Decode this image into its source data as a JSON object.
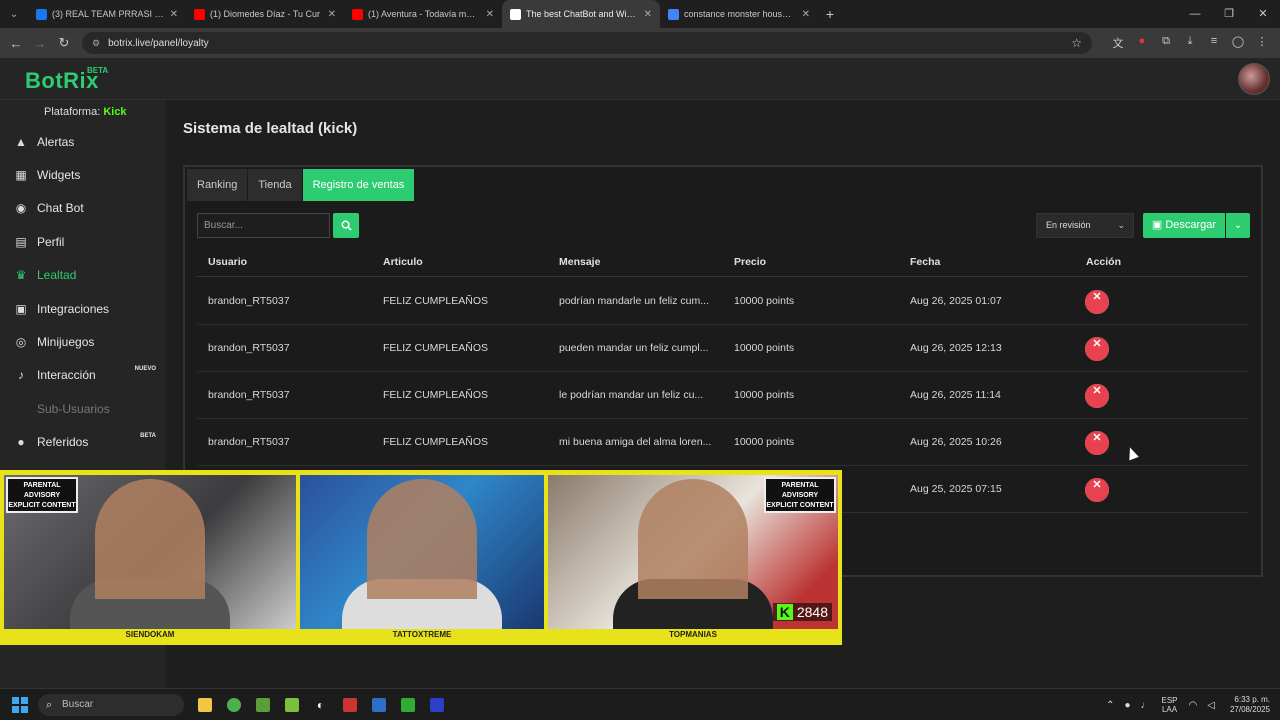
{
  "browser": {
    "tabs": [
      {
        "title": "(3) REAL TEAM PRRASI | Facebo",
        "color": "#1877f2",
        "icon": "facebook-icon"
      },
      {
        "title": "(1) Diomedes Díaz - Tu Cur",
        "color": "#ff0000",
        "icon": "youtube-icon"
      },
      {
        "title": "(1) Aventura - Todavía me ama",
        "color": "#ff0000",
        "icon": "youtube-icon"
      },
      {
        "title": "The best ChatBot and Widgets",
        "color": "#ffffff",
        "icon": "botrix-icon"
      },
      {
        "title": "constance monster house - Bus",
        "color": "#4285f4",
        "icon": "google-icon"
      }
    ],
    "url": "botrix.live/panel/loyalty"
  },
  "app": {
    "logo": "BotRix",
    "logo_badge": "BETA",
    "platform_label": "Plataforma:",
    "platform_value": "Kick",
    "accent": "#2ecc71"
  },
  "sidebar": {
    "items": [
      {
        "label": "Alertas",
        "icon": "warning-icon",
        "glyph": "▲"
      },
      {
        "label": "Widgets",
        "icon": "grid-icon",
        "glyph": "▦"
      },
      {
        "label": "Chat Bot",
        "icon": "robot-icon",
        "glyph": "◉"
      },
      {
        "label": "Perfil",
        "icon": "id-card-icon",
        "glyph": "▤"
      },
      {
        "label": "Lealtad",
        "icon": "trophy-icon",
        "glyph": "♛",
        "active": true
      },
      {
        "label": "Integraciones",
        "icon": "plug-icon",
        "glyph": "▣"
      },
      {
        "label": "Minijuegos",
        "icon": "gamepad-icon",
        "glyph": "◎"
      },
      {
        "label": "Interacción",
        "icon": "music-icon",
        "glyph": "♪",
        "badge": "NUEVO"
      },
      {
        "label": "Sub-Usuarios",
        "icon": "users-icon",
        "glyph": "",
        "disabled": true
      },
      {
        "label": "Referidos",
        "icon": "users-icon",
        "glyph": "●",
        "badge": "BETA"
      }
    ]
  },
  "page": {
    "title": "Sistema de lealtad (kick)",
    "tabs": [
      "Ranking",
      "Tienda",
      "Registro de ventas"
    ],
    "active_tab": "Registro de ventas",
    "search_placeholder": "Buscar...",
    "status_filter": "En revisión",
    "download_label": "Descargar"
  },
  "table": {
    "headers": [
      "Usuario",
      "Articulo",
      "Mensaje",
      "Precio",
      "Fecha",
      "Acción"
    ],
    "rows": [
      {
        "usuario": "brandon_RT5037",
        "articulo": "FELIZ CUMPLEAÑOS",
        "mensaje": "podrían mandarle un feliz cum...",
        "precio": "10000 points",
        "fecha": "Aug 26, 2025 01:07"
      },
      {
        "usuario": "brandon_RT5037",
        "articulo": "FELIZ CUMPLEAÑOS",
        "mensaje": "pueden mandar un feliz cumpl...",
        "precio": "10000 points",
        "fecha": "Aug 26, 2025 12:13"
      },
      {
        "usuario": "brandon_RT5037",
        "articulo": "FELIZ CUMPLEAÑOS",
        "mensaje": "le podrían mandar un feliz cu...",
        "precio": "10000 points",
        "fecha": "Aug 26, 2025 11:14"
      },
      {
        "usuario": "brandon_RT5037",
        "articulo": "FELIZ CUMPLEAÑOS",
        "mensaje": "mi buena amiga del alma loren...",
        "precio": "10000 points",
        "fecha": "Aug 26, 2025 10:26"
      },
      {
        "usuario": "",
        "articulo": "",
        "mensaje": "",
        "precio": "",
        "fecha": "Aug 25, 2025 07:15"
      }
    ]
  },
  "overlay": {
    "advisory": "PARENTAL ADVISORY EXPLICIT CONTENT",
    "cams": [
      "SIENDOKAM",
      "TATTOXTREME",
      "TOPMANIAS"
    ],
    "viewer_count": "2848",
    "viewer_badge": "K"
  },
  "taskbar": {
    "search": "Buscar",
    "lang_line1": "ESP",
    "lang_line2": "LAA",
    "time": "6:33 p. m.",
    "date": "27/08/2025"
  }
}
